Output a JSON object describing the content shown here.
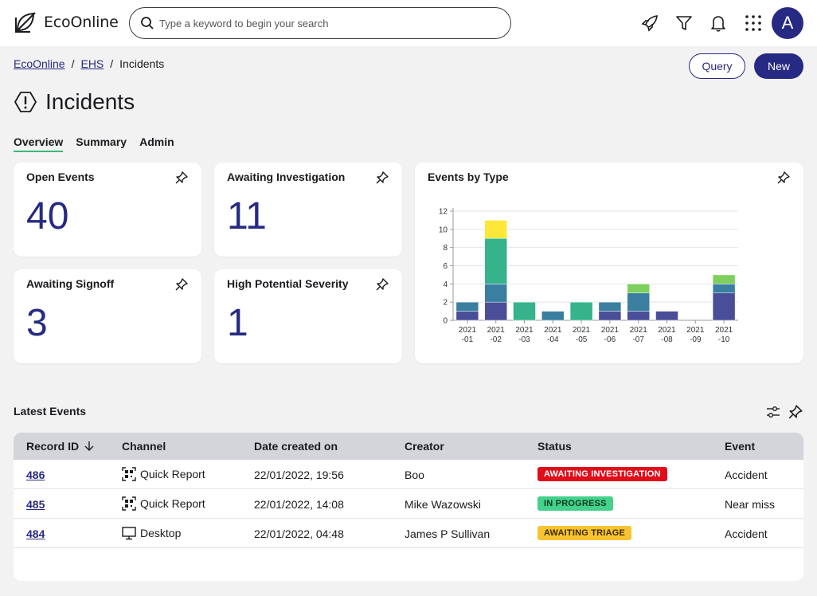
{
  "app": {
    "brand": "EcoOnline"
  },
  "search": {
    "placeholder": "Type a keyword to begin your search"
  },
  "user": {
    "avatar_letter": "A"
  },
  "breadcrumb": [
    "EcoOnline",
    "EHS",
    "Incidents"
  ],
  "actions": {
    "query_label": "Query",
    "new_label": "New"
  },
  "page": {
    "title": "Incidents"
  },
  "tabs": [
    "Overview",
    "Summary",
    "Admin"
  ],
  "kpis": [
    {
      "label": "Open Events",
      "value": "40"
    },
    {
      "label": "Awaiting Investigation",
      "value": "11"
    },
    {
      "label": "Awaiting Signoff",
      "value": "3"
    },
    {
      "label": "High Potential Severity",
      "value": "1"
    }
  ],
  "chart_card": {
    "title": "Events by Type"
  },
  "chart_data": {
    "type": "bar",
    "stacked": true,
    "categories": [
      "2021\n-01",
      "2021\n-02",
      "2021\n-03",
      "2021\n-04",
      "2021\n-05",
      "2021\n-06",
      "2021\n-07",
      "2021\n-08",
      "2021\n-09",
      "2021\n-10"
    ],
    "series": [
      {
        "color": "#4a4e99",
        "values": [
          1,
          2,
          0,
          0,
          0,
          1,
          1,
          1,
          0,
          3
        ]
      },
      {
        "color": "#3a7fa0",
        "values": [
          1,
          2,
          0,
          1,
          0,
          1,
          2,
          0,
          0,
          1
        ]
      },
      {
        "color": "#36b38a",
        "values": [
          0,
          5,
          2,
          0,
          2,
          0,
          0,
          0,
          0,
          0
        ]
      },
      {
        "color": "#7ed05d",
        "values": [
          0,
          0,
          0,
          0,
          0,
          0,
          1,
          0,
          0,
          1
        ]
      },
      {
        "color": "#fde73a",
        "values": [
          0,
          2,
          0,
          0,
          0,
          0,
          0,
          0,
          0,
          0
        ]
      }
    ],
    "yticks": [
      0,
      2,
      4,
      6,
      8,
      10,
      12
    ],
    "ylim": [
      0,
      12
    ],
    "grid": true,
    "legend": "none"
  },
  "latest": {
    "title": "Latest Events",
    "columns": [
      "Record ID",
      "Channel",
      "Date created on",
      "Creator",
      "Status",
      "Event"
    ],
    "rows": [
      {
        "id": "486",
        "channel": "Quick Report",
        "channel_icon": "qr-icon",
        "date": "22/01/2022, 19:56",
        "creator": "Boo",
        "status": "AWAITING INVESTIGATION",
        "status_bg": "#e00d1a",
        "status_fg": "#ffffff",
        "event": "Accident"
      },
      {
        "id": "485",
        "channel": "Quick Report",
        "channel_icon": "qr-icon",
        "date": "22/01/2022, 14:08",
        "creator": "Mike Wazowski",
        "status": "IN PROGRESS",
        "status_bg": "#43d18b",
        "status_fg": "#0e3b22",
        "event": "Near miss"
      },
      {
        "id": "484",
        "channel": "Desktop",
        "channel_icon": "desktop-icon",
        "date": "22/01/2022, 04:48",
        "creator": "James P Sullivan",
        "status": "AWAITING TRIAGE",
        "status_bg": "#f8c330",
        "status_fg": "#3a2a00",
        "event": "Accident"
      }
    ]
  },
  "colors": {
    "accent": "#262a82",
    "tab_underline": "#3cb878"
  }
}
